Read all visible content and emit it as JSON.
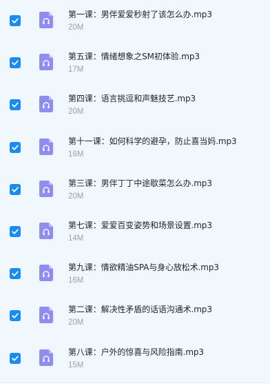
{
  "colors": {
    "list_background": "#f0f7fd",
    "checkbox": "#1a8cf0",
    "file_icon": "#8f8cf2",
    "file_name": "#1f2329",
    "file_size": "#9aa1ab"
  },
  "files": [
    {
      "name": "第一课：男伴爱爱秒射了该怎么办.mp3",
      "size": "20M",
      "checked": true,
      "icon": "audio-file-icon"
    },
    {
      "name": "第五课：情绪想象之SM初体验.mp3",
      "size": "17M",
      "checked": true,
      "icon": "audio-file-icon"
    },
    {
      "name": "第四课：语言挑逗和声魅技艺.mp3",
      "size": "20M",
      "checked": true,
      "icon": "audio-file-icon"
    },
    {
      "name": "第十一课：如何科学的避孕，防止喜当妈.mp3",
      "size": "16M",
      "checked": true,
      "icon": "audio-file-icon"
    },
    {
      "name": "第三课：男伴丁丁中途歇菜怎么办.mp3",
      "size": "20M",
      "checked": true,
      "icon": "audio-file-icon"
    },
    {
      "name": "第七课：爱爱百变姿势和场景设置.mp3",
      "size": "14M",
      "checked": true,
      "icon": "audio-file-icon"
    },
    {
      "name": "第九课：情欲精油SPA与身心放松术.mp3",
      "size": "16M",
      "checked": true,
      "icon": "audio-file-icon"
    },
    {
      "name": "第二课：解决性矛盾的话语沟通术.mp3",
      "size": "20M",
      "checked": true,
      "icon": "audio-file-icon"
    },
    {
      "name": "第八课：户外的惊喜与风险指南.mp3",
      "size": "15M",
      "checked": true,
      "icon": "audio-file-icon"
    }
  ]
}
